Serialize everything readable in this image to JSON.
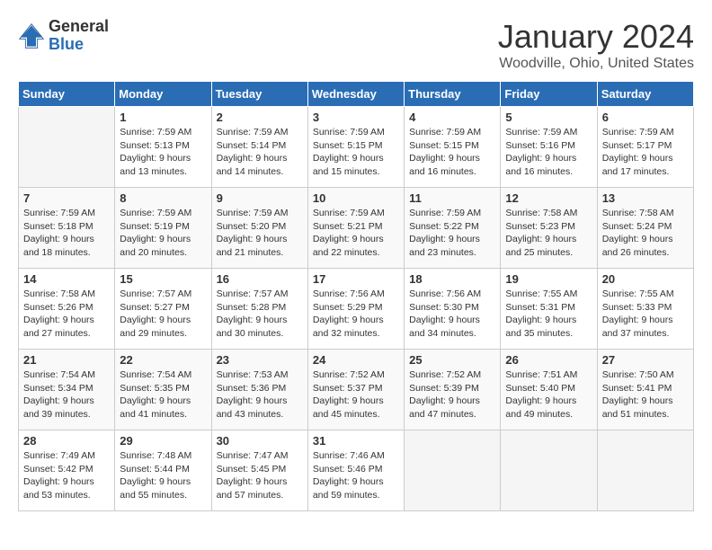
{
  "logo": {
    "general": "General",
    "blue": "Blue"
  },
  "title": "January 2024",
  "subtitle": "Woodville, Ohio, United States",
  "headers": [
    "Sunday",
    "Monday",
    "Tuesday",
    "Wednesday",
    "Thursday",
    "Friday",
    "Saturday"
  ],
  "weeks": [
    [
      {
        "day": "",
        "sunrise": "",
        "sunset": "",
        "daylight": ""
      },
      {
        "day": "1",
        "sunrise": "Sunrise: 7:59 AM",
        "sunset": "Sunset: 5:13 PM",
        "daylight": "Daylight: 9 hours and 13 minutes."
      },
      {
        "day": "2",
        "sunrise": "Sunrise: 7:59 AM",
        "sunset": "Sunset: 5:14 PM",
        "daylight": "Daylight: 9 hours and 14 minutes."
      },
      {
        "day": "3",
        "sunrise": "Sunrise: 7:59 AM",
        "sunset": "Sunset: 5:15 PM",
        "daylight": "Daylight: 9 hours and 15 minutes."
      },
      {
        "day": "4",
        "sunrise": "Sunrise: 7:59 AM",
        "sunset": "Sunset: 5:15 PM",
        "daylight": "Daylight: 9 hours and 16 minutes."
      },
      {
        "day": "5",
        "sunrise": "Sunrise: 7:59 AM",
        "sunset": "Sunset: 5:16 PM",
        "daylight": "Daylight: 9 hours and 16 minutes."
      },
      {
        "day": "6",
        "sunrise": "Sunrise: 7:59 AM",
        "sunset": "Sunset: 5:17 PM",
        "daylight": "Daylight: 9 hours and 17 minutes."
      }
    ],
    [
      {
        "day": "7",
        "sunrise": "Sunrise: 7:59 AM",
        "sunset": "Sunset: 5:18 PM",
        "daylight": "Daylight: 9 hours and 18 minutes."
      },
      {
        "day": "8",
        "sunrise": "Sunrise: 7:59 AM",
        "sunset": "Sunset: 5:19 PM",
        "daylight": "Daylight: 9 hours and 20 minutes."
      },
      {
        "day": "9",
        "sunrise": "Sunrise: 7:59 AM",
        "sunset": "Sunset: 5:20 PM",
        "daylight": "Daylight: 9 hours and 21 minutes."
      },
      {
        "day": "10",
        "sunrise": "Sunrise: 7:59 AM",
        "sunset": "Sunset: 5:21 PM",
        "daylight": "Daylight: 9 hours and 22 minutes."
      },
      {
        "day": "11",
        "sunrise": "Sunrise: 7:59 AM",
        "sunset": "Sunset: 5:22 PM",
        "daylight": "Daylight: 9 hours and 23 minutes."
      },
      {
        "day": "12",
        "sunrise": "Sunrise: 7:58 AM",
        "sunset": "Sunset: 5:23 PM",
        "daylight": "Daylight: 9 hours and 25 minutes."
      },
      {
        "day": "13",
        "sunrise": "Sunrise: 7:58 AM",
        "sunset": "Sunset: 5:24 PM",
        "daylight": "Daylight: 9 hours and 26 minutes."
      }
    ],
    [
      {
        "day": "14",
        "sunrise": "Sunrise: 7:58 AM",
        "sunset": "Sunset: 5:26 PM",
        "daylight": "Daylight: 9 hours and 27 minutes."
      },
      {
        "day": "15",
        "sunrise": "Sunrise: 7:57 AM",
        "sunset": "Sunset: 5:27 PM",
        "daylight": "Daylight: 9 hours and 29 minutes."
      },
      {
        "day": "16",
        "sunrise": "Sunrise: 7:57 AM",
        "sunset": "Sunset: 5:28 PM",
        "daylight": "Daylight: 9 hours and 30 minutes."
      },
      {
        "day": "17",
        "sunrise": "Sunrise: 7:56 AM",
        "sunset": "Sunset: 5:29 PM",
        "daylight": "Daylight: 9 hours and 32 minutes."
      },
      {
        "day": "18",
        "sunrise": "Sunrise: 7:56 AM",
        "sunset": "Sunset: 5:30 PM",
        "daylight": "Daylight: 9 hours and 34 minutes."
      },
      {
        "day": "19",
        "sunrise": "Sunrise: 7:55 AM",
        "sunset": "Sunset: 5:31 PM",
        "daylight": "Daylight: 9 hours and 35 minutes."
      },
      {
        "day": "20",
        "sunrise": "Sunrise: 7:55 AM",
        "sunset": "Sunset: 5:33 PM",
        "daylight": "Daylight: 9 hours and 37 minutes."
      }
    ],
    [
      {
        "day": "21",
        "sunrise": "Sunrise: 7:54 AM",
        "sunset": "Sunset: 5:34 PM",
        "daylight": "Daylight: 9 hours and 39 minutes."
      },
      {
        "day": "22",
        "sunrise": "Sunrise: 7:54 AM",
        "sunset": "Sunset: 5:35 PM",
        "daylight": "Daylight: 9 hours and 41 minutes."
      },
      {
        "day": "23",
        "sunrise": "Sunrise: 7:53 AM",
        "sunset": "Sunset: 5:36 PM",
        "daylight": "Daylight: 9 hours and 43 minutes."
      },
      {
        "day": "24",
        "sunrise": "Sunrise: 7:52 AM",
        "sunset": "Sunset: 5:37 PM",
        "daylight": "Daylight: 9 hours and 45 minutes."
      },
      {
        "day": "25",
        "sunrise": "Sunrise: 7:52 AM",
        "sunset": "Sunset: 5:39 PM",
        "daylight": "Daylight: 9 hours and 47 minutes."
      },
      {
        "day": "26",
        "sunrise": "Sunrise: 7:51 AM",
        "sunset": "Sunset: 5:40 PM",
        "daylight": "Daylight: 9 hours and 49 minutes."
      },
      {
        "day": "27",
        "sunrise": "Sunrise: 7:50 AM",
        "sunset": "Sunset: 5:41 PM",
        "daylight": "Daylight: 9 hours and 51 minutes."
      }
    ],
    [
      {
        "day": "28",
        "sunrise": "Sunrise: 7:49 AM",
        "sunset": "Sunset: 5:42 PM",
        "daylight": "Daylight: 9 hours and 53 minutes."
      },
      {
        "day": "29",
        "sunrise": "Sunrise: 7:48 AM",
        "sunset": "Sunset: 5:44 PM",
        "daylight": "Daylight: 9 hours and 55 minutes."
      },
      {
        "day": "30",
        "sunrise": "Sunrise: 7:47 AM",
        "sunset": "Sunset: 5:45 PM",
        "daylight": "Daylight: 9 hours and 57 minutes."
      },
      {
        "day": "31",
        "sunrise": "Sunrise: 7:46 AM",
        "sunset": "Sunset: 5:46 PM",
        "daylight": "Daylight: 9 hours and 59 minutes."
      },
      {
        "day": "",
        "sunrise": "",
        "sunset": "",
        "daylight": ""
      },
      {
        "day": "",
        "sunrise": "",
        "sunset": "",
        "daylight": ""
      },
      {
        "day": "",
        "sunrise": "",
        "sunset": "",
        "daylight": ""
      }
    ]
  ]
}
